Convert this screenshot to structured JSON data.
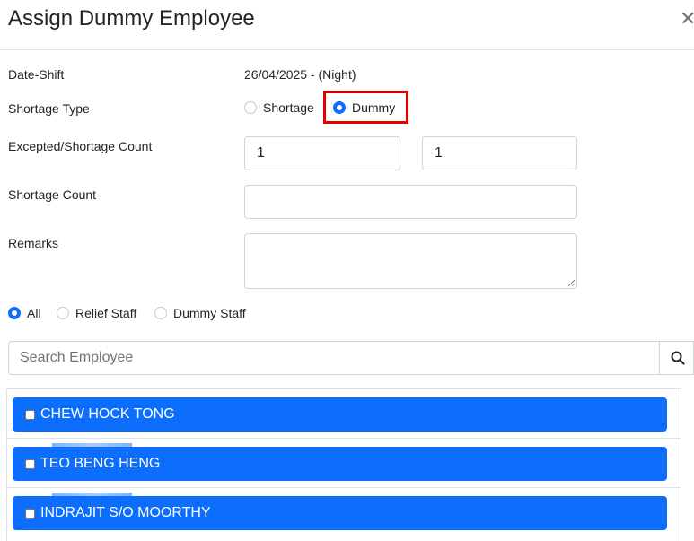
{
  "modal": {
    "title": "Assign Dummy Employee",
    "close_icon": "close-icon"
  },
  "form": {
    "date_shift_label": "Date-Shift",
    "date_shift_value": "26/04/2025 - (Night)",
    "shortage_type_label": "Shortage Type",
    "shortage_type_options": [
      {
        "label": "Shortage",
        "selected": false
      },
      {
        "label": "Dummy",
        "selected": true
      }
    ],
    "expected_count_label": "Excepted/Shortage Count",
    "expected_count_value": "1",
    "shortage_count_value_2": "1",
    "shortage_count_label": "Shortage Count",
    "shortage_count_value": "",
    "remarks_label": "Remarks",
    "remarks_value": ""
  },
  "filter": {
    "options": [
      {
        "label": "All",
        "selected": true
      },
      {
        "label": "Relief Staff",
        "selected": false
      },
      {
        "label": "Dummy Staff",
        "selected": false
      }
    ]
  },
  "search": {
    "placeholder": "Search Employee",
    "icon": "search-icon"
  },
  "employees": [
    {
      "name": "CHEW HOCK TONG",
      "checked": false
    },
    {
      "name": "TEO BENG HENG",
      "checked": false
    },
    {
      "name": "INDRAJIT S/O MOORTHY",
      "checked": false
    }
  ],
  "colors": {
    "accent": "#0d6efd",
    "highlight": "#e00000"
  }
}
